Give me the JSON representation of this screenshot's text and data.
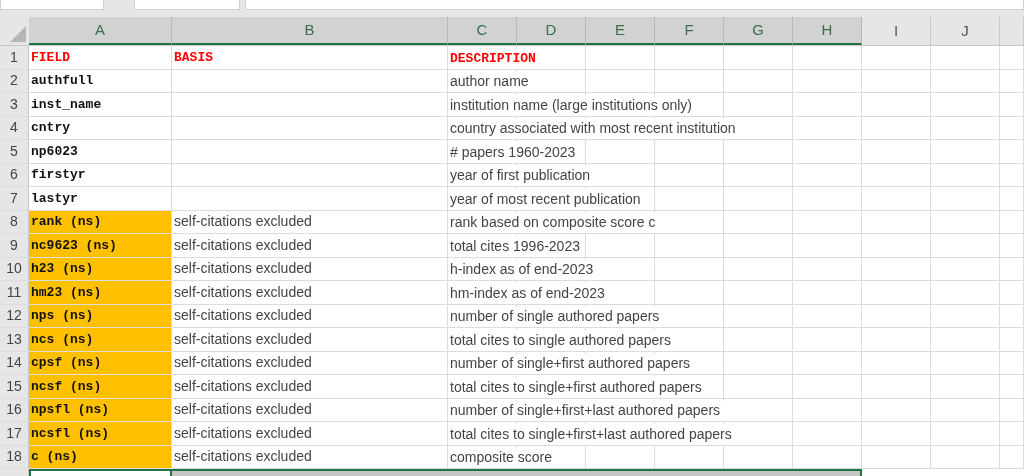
{
  "columns": [
    {
      "label": "A",
      "selected": true
    },
    {
      "label": "B",
      "selected": true
    },
    {
      "label": "C",
      "selected": true
    },
    {
      "label": "D",
      "selected": true
    },
    {
      "label": "E",
      "selected": true
    },
    {
      "label": "F",
      "selected": true
    },
    {
      "label": "G",
      "selected": true
    },
    {
      "label": "H",
      "selected": true
    },
    {
      "label": "I",
      "selected": false
    },
    {
      "label": "J",
      "selected": false
    }
  ],
  "rows": [
    {
      "number": "1",
      "kind": "header",
      "field": "FIELD",
      "basis": "BASIS",
      "description": "DESCRIPTION",
      "highlighted": false
    },
    {
      "number": "2",
      "kind": "data",
      "field": "authfull",
      "description": "author name",
      "highlighted": false
    },
    {
      "number": "3",
      "kind": "data",
      "field": "inst_name",
      "description": "institution name (large institutions only)",
      "highlighted": false
    },
    {
      "number": "4",
      "kind": "data",
      "field": "cntry",
      "description": "country associated with most recent institution",
      "highlighted": false
    },
    {
      "number": "5",
      "kind": "data",
      "field": "np6023",
      "description": "# papers 1960-2023",
      "highlighted": false
    },
    {
      "number": "6",
      "kind": "data",
      "field": "firstyr",
      "description": "year of first publication",
      "highlighted": false
    },
    {
      "number": "7",
      "kind": "data",
      "field": "lastyr",
      "description": "year of most recent publication",
      "highlighted": false
    },
    {
      "number": "8",
      "kind": "data",
      "field": "rank (ns)",
      "basis": "self-citations excluded",
      "description": "rank based on composite score c",
      "highlighted": true
    },
    {
      "number": "9",
      "kind": "data",
      "field": "nc9623 (ns)",
      "basis": "self-citations excluded",
      "description": "total cites 1996-2023",
      "highlighted": true
    },
    {
      "number": "10",
      "kind": "data",
      "field": "h23 (ns)",
      "basis": "self-citations excluded",
      "description": "h-index as of end-2023",
      "highlighted": true
    },
    {
      "number": "11",
      "kind": "data",
      "field": "hm23 (ns)",
      "basis": "self-citations excluded",
      "description": "hm-index as of end-2023",
      "highlighted": true
    },
    {
      "number": "12",
      "kind": "data",
      "field": "nps (ns)",
      "basis": "self-citations excluded",
      "description": "number of single authored papers",
      "highlighted": true
    },
    {
      "number": "13",
      "kind": "data",
      "field": "ncs (ns)",
      "basis": "self-citations excluded",
      "description": "total cites to single authored papers",
      "highlighted": true
    },
    {
      "number": "14",
      "kind": "data",
      "field": "cpsf (ns)",
      "basis": "self-citations excluded",
      "description": "number of single+first authored papers",
      "highlighted": true
    },
    {
      "number": "15",
      "kind": "data",
      "field": "ncsf (ns)",
      "basis": "self-citations excluded",
      "description": "total cites to single+first authored papers",
      "highlighted": true
    },
    {
      "number": "16",
      "kind": "data",
      "field": "npsfl (ns)",
      "basis": "self-citations excluded",
      "description": "number of single+first+last authored papers",
      "highlighted": true
    },
    {
      "number": "17",
      "kind": "data",
      "field": "ncsfl (ns)",
      "basis": "self-citations excluded",
      "description": "total cites to single+first+last authored papers",
      "highlighted": true
    },
    {
      "number": "18",
      "kind": "data",
      "field": "c (ns)",
      "basis": "self-citations excluded",
      "description": "composite score",
      "highlighted": true
    }
  ]
}
